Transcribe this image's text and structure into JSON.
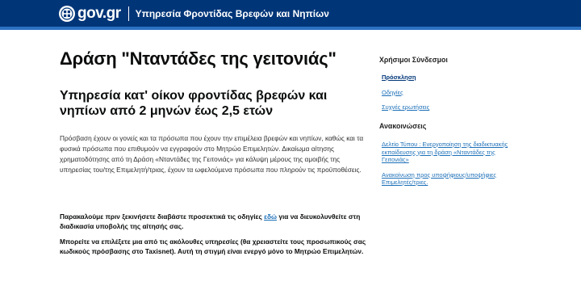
{
  "header": {
    "logo_text": "gov.gr",
    "service_name": "Υπηρεσία Φροντίδας Βρεφών και Νηπίων"
  },
  "main": {
    "title": "Δράση \"Νταντάδες της γειτονιάς\"",
    "subtitle": "Υπηρεσία κατ' οίκον φροντίδας βρεφών και νηπίων από 2 μηνών έως 2,5 ετών",
    "intro": "Πρόσβαση έχουν οι γονείς και τα πρόσωπα που έχουν την επιμέλεια βρεφών και νηπίων, καθώς και τα φυσικά πρόσωπα που επιθυμούν να εγγραφούν στο Μητρώο Επιμελητών. Δικαίωμα αίτησης χρηματοδότησης από τη Δράση «Νταντάδες της Γειτονιάς» για κάλυψη μέρους της αμοιβής της υπηρεσίας του/της Επιμελητή/τριας, έχουν τα ωφελούμενα πρόσωπα που πληρούν τις προϋποθέσεις.",
    "notice_before": "Παρακαλούμε πριν ξεκινήσετε διαβάστε προσεκτικά τις οδηγίες ",
    "notice_link": "εδώ",
    "notice_after": " για να διευκολυνθείτε στη διαδικασία υποβολής της αίτησής σας.",
    "options_text": "Μπορείτε να επιλέξετε μια από τις ακόλουθες υπηρεσίες (θα χρειαστείτε τους προσωπικούς σας κωδικούς πρόσβασης στο Taxisnet). Αυτή τη στιγμή είναι ενεργό μόνο το Μητρώο Επιμελητών."
  },
  "sidebar": {
    "links_title": "Χρήσιμοι Σύνδεσμοι",
    "links": [
      {
        "label": "Πρόσκληση"
      },
      {
        "label": "Οδηγίες"
      },
      {
        "label": "Συχνές ερωτήσεις"
      }
    ],
    "announcements_title": "Ανακοινώσεις",
    "announcements": [
      {
        "label": "Δελτίο Τύπου : Ενεργοποίηση της διαδικτυακής εκπαίδευσης για τη δράση «Νταντάδες της Γειτονιάς»"
      },
      {
        "label": "Ανακοίνωση προς υποψήφιους/υποψήφιες Επιμελητές/τριες."
      }
    ]
  }
}
